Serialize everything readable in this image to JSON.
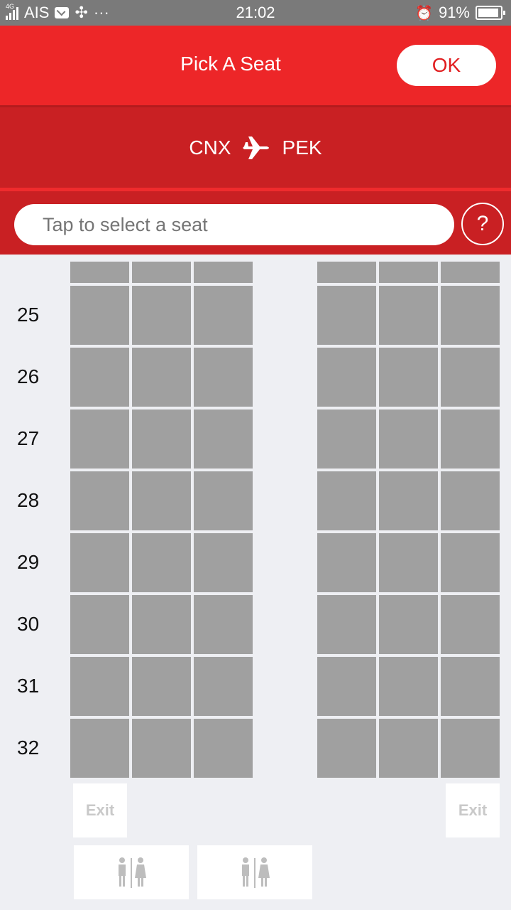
{
  "status_bar": {
    "network": "4G",
    "carrier": "AIS",
    "dots": "···",
    "time": "21:02",
    "battery": "91%"
  },
  "header": {
    "title": "Pick A Seat",
    "ok_label": "OK"
  },
  "route": {
    "origin": "CNX",
    "destination": "PEK"
  },
  "search": {
    "placeholder": "Tap to select a seat",
    "help_label": "?"
  },
  "seat_map": {
    "rows": [
      "25",
      "26",
      "27",
      "28",
      "29",
      "30",
      "31",
      "32"
    ],
    "left_columns": 3,
    "right_columns": 3,
    "exit_label": "Exit"
  },
  "colors": {
    "primary_red": "#ed2628",
    "dark_red": "#c92023",
    "seat_gray": "#a0a0a0",
    "background": "#eeeff3"
  }
}
